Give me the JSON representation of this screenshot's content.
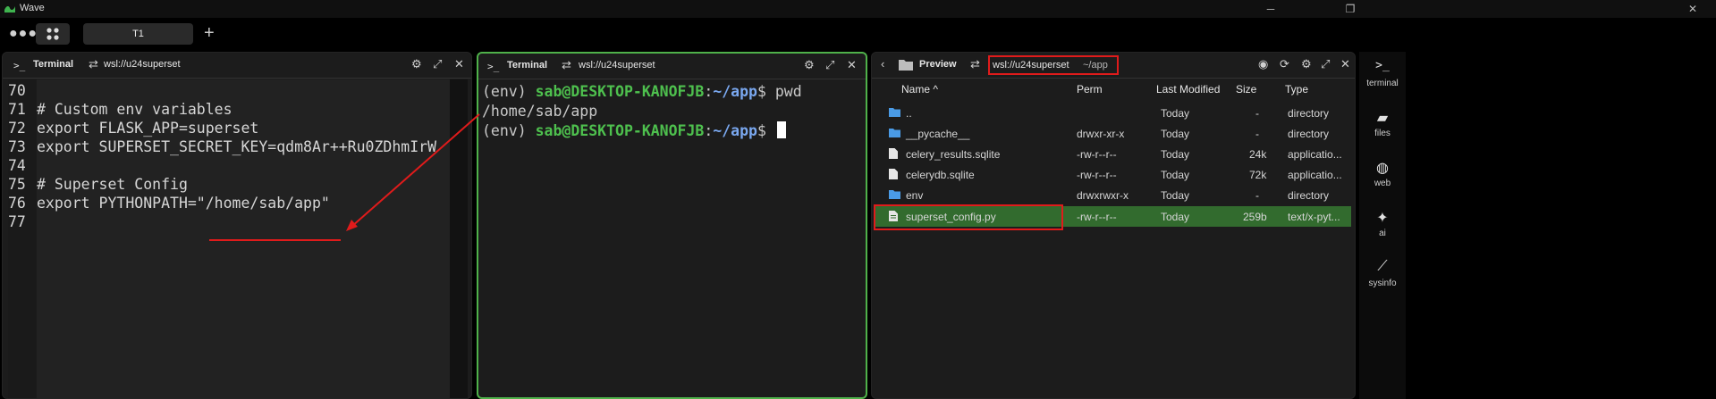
{
  "window": {
    "title": "Wave",
    "minimize_glyph": "─",
    "restore_glyph": "❐",
    "close_glyph": "✕"
  },
  "tabbar": {
    "tab_label": "T1",
    "add_label": "+",
    "dots_label": "●●●"
  },
  "blocks": [
    {
      "label": "Terminal",
      "connection": "wsl://u24superset",
      "icon": "terminal-icon"
    },
    {
      "label": "Terminal",
      "connection": "wsl://u24superset",
      "icon": "terminal-icon"
    },
    {
      "label": "Preview",
      "connection": "wsl://u24superset",
      "path": "~/app",
      "icon": "folder-icon"
    }
  ],
  "editor": {
    "lines": [
      {
        "num": "70",
        "text": ""
      },
      {
        "num": "71",
        "text": "# Custom env variables"
      },
      {
        "num": "72",
        "text": "export FLASK_APP=superset"
      },
      {
        "num": "73",
        "text": "export SUPERSET_SECRET_KEY=qdm8Ar++Ru0ZDhmIrW"
      },
      {
        "num": "74",
        "text": ""
      },
      {
        "num": "75",
        "text": "# Superset Config"
      },
      {
        "num": "76",
        "text": "export PYTHONPATH=\"/home/sab/app\""
      },
      {
        "num": "77",
        "text": ""
      }
    ]
  },
  "terminal": {
    "env": "(env) ",
    "user": "sab@DESKTOP-KANOFJB",
    "colon": ":",
    "path": "~/app",
    "dollar": "$",
    "cmd1": " pwd",
    "output1": "/home/sab/app"
  },
  "files": {
    "headers": {
      "name": "Name ^",
      "perm": "Perm",
      "modified": "Last Modified",
      "size": "Size",
      "type": "Type"
    },
    "rows": [
      {
        "name": "..",
        "perm": "",
        "modified": "Today",
        "size": "-",
        "type": "directory",
        "kind": "folder"
      },
      {
        "name": "__pycache__",
        "perm": "drwxr-xr-x",
        "modified": "Today",
        "size": "-",
        "type": "directory",
        "kind": "folder"
      },
      {
        "name": "celery_results.sqlite",
        "perm": "-rw-r--r--",
        "modified": "Today",
        "size": "24k",
        "type": "applicatio...",
        "kind": "file"
      },
      {
        "name": "celerydb.sqlite",
        "perm": "-rw-r--r--",
        "modified": "Today",
        "size": "72k",
        "type": "applicatio...",
        "kind": "file"
      },
      {
        "name": "env",
        "perm": "drwxrwxr-x",
        "modified": "Today",
        "size": "-",
        "type": "directory",
        "kind": "folder"
      },
      {
        "name": "superset_config.py",
        "perm": "-rw-r--r--",
        "modified": "Today",
        "size": "259b",
        "type": "text/x-pyt...",
        "kind": "file-text",
        "selected": true
      }
    ]
  },
  "sidebar": {
    "items": [
      {
        "label": "terminal",
        "icon": "terminal-icon"
      },
      {
        "label": "files",
        "icon": "folder-icon"
      },
      {
        "label": "web",
        "icon": "globe-icon"
      },
      {
        "label": "ai",
        "icon": "sparkle-icon"
      },
      {
        "label": "sysinfo",
        "icon": "chart-icon"
      }
    ]
  },
  "colors": {
    "focus": "#4fb14a",
    "annotation": "#e01b1b",
    "selected_row": "#326b2e",
    "prompt_user": "#4ec04e",
    "prompt_path": "#7aa8f0"
  }
}
